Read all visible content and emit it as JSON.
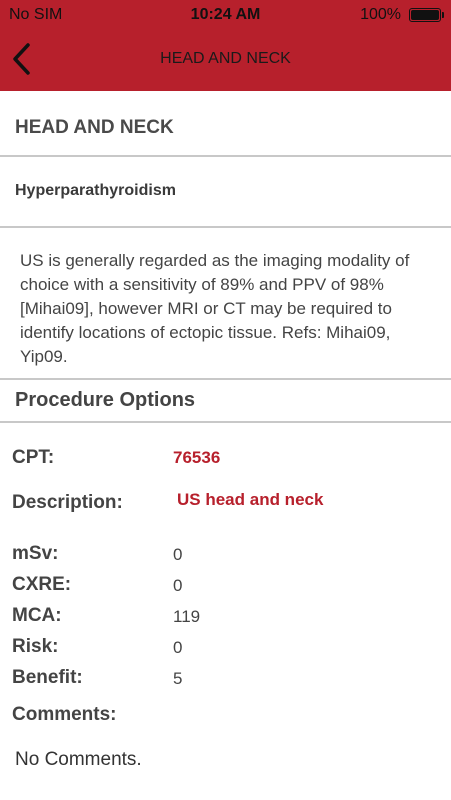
{
  "status": {
    "carrier": "No SIM",
    "time": "10:24 AM",
    "battery": "100%",
    "battery_level": 1.0
  },
  "nav": {
    "title": "HEAD AND NECK",
    "back_icon": "chevron-left-icon"
  },
  "section": {
    "title": "HEAD AND NECK"
  },
  "condition": {
    "title": "Hyperparathyroidism"
  },
  "description": "US is generally regarded as the imaging modality of choice with a sensitivity of 89% and PPV of 98% [Mihai09], however MRI or CT may be required to identify locations of ectopic tissue. Refs: Mihai09, Yip09.",
  "procedure": {
    "title": "Procedure Options",
    "cpt_label": "CPT:",
    "cpt": "76536",
    "description_label": "Description:",
    "description": "US head and neck",
    "msv_label": "mSv:",
    "msv": "0",
    "cxre_label": "CXRE:",
    "cxre": "0",
    "mca_label": "MCA:",
    "mca": "119",
    "risk_label": "Risk:",
    "risk": "0",
    "benefit_label": "Benefit:",
    "benefit": "5",
    "comments_label": "Comments:",
    "comments": "No Comments."
  },
  "colors": {
    "brand": "#b7202c",
    "divider": "#c8c8c8"
  }
}
